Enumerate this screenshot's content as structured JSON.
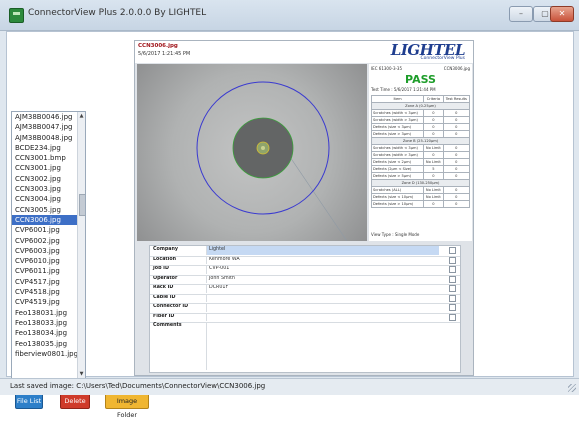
{
  "window": {
    "title": "ConnectorView Plus 2.0.0.0 By LIGHTEL",
    "min_glyph": "–",
    "max_glyph": "▢",
    "close_glyph": "✕"
  },
  "file_list": {
    "items": [
      "AJM38B0046.jpg",
      "AJM38B0047.jpg",
      "AJM38B0048.jpg",
      "BCDE234.jpg",
      "CCN3001.bmp",
      "CCN3001.jpg",
      "CCN3002.jpg",
      "CCN3003.jpg",
      "CCN3004.jpg",
      "CCN3005.jpg",
      "CCN3006.jpg",
      "CVP6001.jpg",
      "CVP6002.jpg",
      "CVP6003.jpg",
      "CVP6010.jpg",
      "CVP6011.jpg",
      "CVP4517.jpg",
      "CVP4518.jpg",
      "CVP4519.jpg",
      "Feo138031.jpg",
      "Feo138033.jpg",
      "Feo138034.jpg",
      "Feo138035.jpg",
      "fiberview0801.jpg"
    ],
    "selected_index": 10,
    "scroll_up_glyph": "▲",
    "scroll_down_glyph": "▼"
  },
  "report": {
    "file_name": "CCN3006.jpg",
    "date": "5/6/2017 1:21:45 PM",
    "logo": "LIGHTEL",
    "logo_sub": "ConnectorView Plus",
    "results": {
      "header_left": "IEC 61300-3-35",
      "header_right": "CCN3006.jpg",
      "status": "PASS",
      "test_time": "Test Time : 5/6/2017 1:21:44 PM",
      "columns": [
        "Item",
        "Criteria",
        "Test Results"
      ],
      "zones": [
        {
          "name": "Zone A (0-25μm)",
          "rows": [
            [
              "Scratches (width < 3μm)",
              "0",
              "0"
            ],
            [
              "Scratches (width > 3μm)",
              "0",
              "0"
            ],
            [
              "Defects (size < 3μm)",
              "0",
              "0"
            ],
            [
              "Defects (size > 3μm)",
              "0",
              "0"
            ]
          ]
        },
        {
          "name": "Zone B (25-120μm)",
          "rows": [
            [
              "Scratches (width < 3μm)",
              "No Limit",
              "0"
            ],
            [
              "Scratches (width > 3μm)",
              "0",
              "0"
            ],
            [
              "Defects (size < 2μm)",
              "No Limit",
              "0"
            ],
            [
              "Defects (2μm < Size)",
              "5",
              "0"
            ],
            [
              "Defects (size > 5μm)",
              "0",
              "0"
            ]
          ]
        },
        {
          "name": "Zone D (130-250μm)",
          "rows": [
            [
              "Scratches (ALL)",
              "No Limit",
              "0"
            ],
            [
              "Defects (size < 10μm)",
              "No Limit",
              "0"
            ],
            [
              "Defects (size > 10μm)",
              "0",
              "0"
            ]
          ]
        }
      ],
      "view_type": "View Type : Single Mode"
    },
    "info": {
      "fields": [
        {
          "label": "Company",
          "value": "Lightel"
        },
        {
          "label": "Location",
          "value": "Kenmore WA"
        },
        {
          "label": "Job ID",
          "value": "CVP-001"
        },
        {
          "label": "Operator",
          "value": "John Smith"
        },
        {
          "label": "Rack ID",
          "value": "DCR01F"
        },
        {
          "label": "Cable ID",
          "value": ""
        },
        {
          "label": "Connector ID",
          "value": ""
        },
        {
          "label": "Fiber ID",
          "value": ""
        }
      ],
      "comments_label": "Comments"
    }
  },
  "buttons": {
    "file_list": "File List",
    "delete": "Delete",
    "image_folder": "Image Folder"
  },
  "status_bar": {
    "text": "Last saved image:  C:\\Users\\Ted\\Documents\\ConnectorView\\CCN3006.jpg"
  },
  "colors": {
    "pass": "#1e9d2a",
    "file_button": "#2d7fc9",
    "delete_button": "#cf3b2a",
    "image_folder_button": "#f0b631",
    "selection": "#3d6fc6"
  }
}
